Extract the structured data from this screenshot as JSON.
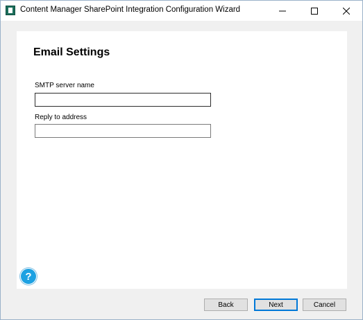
{
  "window": {
    "title": "Content Manager SharePoint Integration Configuration Wizard"
  },
  "page": {
    "heading": "Email Settings",
    "fields": [
      {
        "label": "SMTP server name",
        "value": ""
      },
      {
        "label": "Reply to address",
        "value": ""
      }
    ]
  },
  "help": {
    "glyph": "?"
  },
  "buttons": {
    "back": "Back",
    "next": "Next",
    "cancel": "Cancel"
  },
  "colors": {
    "accent": "#0078d7",
    "help": "#1da1e2",
    "app_icon": "#1c6e5b"
  }
}
